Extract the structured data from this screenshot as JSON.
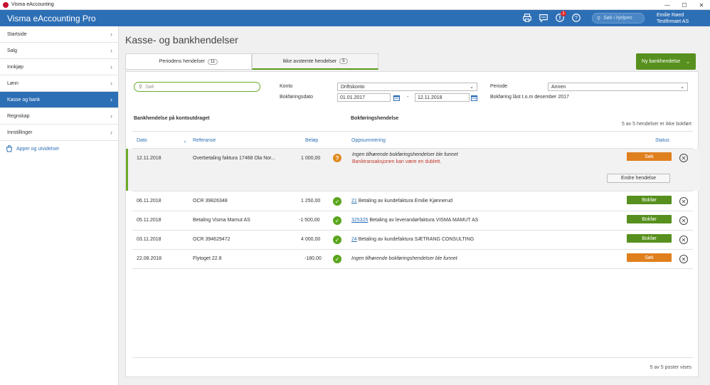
{
  "window": {
    "title": "Visma eAccounting",
    "minimize": "—",
    "maximize": "☐",
    "close": "✕"
  },
  "header": {
    "brand": "Visma eAccounting Pro",
    "notification_count": "1",
    "search_placeholder": "Søk i hjelpen",
    "user_name": "Emilie Røed",
    "company": "Testfirmaet AS"
  },
  "sidebar": {
    "items": [
      {
        "label": "Startside",
        "active": false
      },
      {
        "label": "Salg",
        "active": false
      },
      {
        "label": "Innkjøp",
        "active": false
      },
      {
        "label": "Lønn",
        "active": false
      },
      {
        "label": "Kasse og bank",
        "active": true
      },
      {
        "label": "Regnskap",
        "active": false
      },
      {
        "label": "Innstillinger",
        "active": false
      }
    ],
    "apps_link": "Apper og utvidelser"
  },
  "main": {
    "title": "Kasse- og bankhendelser",
    "tabs": [
      {
        "label": "Periodens hendelser",
        "count": "11"
      },
      {
        "label": "Ikke avstemte hendelser",
        "count": "5"
      }
    ],
    "new_button": "Ny bankhendelse"
  },
  "filters": {
    "search_placeholder": "Søk",
    "account_label": "Konto",
    "account_value": "Driftskonto",
    "date_label": "Bokføringsdato",
    "date_from": "01.01.2017",
    "date_sep": "-",
    "date_to": "12.11.2018",
    "period_label": "Periode",
    "period_value": "Annen",
    "locked_note": "Bokføring låst t.o.m desember 2017"
  },
  "sections": {
    "left": "Bankhendelse på kontoutdraget",
    "right": "Bokføringshendelse",
    "summary": "5 av 5 hendelser er ikke bokført"
  },
  "columns": {
    "date": "Dato",
    "reference": "Referanse",
    "amount": "Beløp",
    "summary": "Oppsummering",
    "status": "Status"
  },
  "rows": [
    {
      "date": "12.11.2018",
      "reference": "Overbetaling faktura 17468 Ola Nor...",
      "amount": "1 000,00",
      "state": "question",
      "link": "",
      "summary": "Ingen tilhørende bokføringshendelser ble funnet",
      "summary_italic": true,
      "warning": "Banktransaksjonen kan være en dublett.",
      "action": "Søk",
      "action_color": "orange",
      "edit": "Endre hendelse"
    },
    {
      "date": "06.11.2018",
      "reference": "OCR 39826348",
      "amount": "1 250,00",
      "state": "ok",
      "link": "21",
      "summary": "Betaling av kundefaktura Emilie Kjønnerud",
      "summary_italic": false,
      "action": "Bokfør",
      "action_color": "green"
    },
    {
      "date": "05.11.2018",
      "reference": "Betaling Visma Mamut AS",
      "amount": "-1 500,00",
      "state": "ok",
      "link": "325325",
      "summary": "Betaling av leverandørfaktura VISMA MAMUT AS",
      "summary_italic": false,
      "action": "Bokfør",
      "action_color": "green"
    },
    {
      "date": "03.11.2018",
      "reference": "OCR 394629472",
      "amount": "4 000,00",
      "state": "ok",
      "link": "24",
      "summary": "Betaling av kundefaktura SÆTRANG CONSULTING",
      "summary_italic": false,
      "action": "Bokfør",
      "action_color": "green"
    },
    {
      "date": "22.08.2018",
      "reference": "Flytoget 22.8",
      "amount": "-180,00",
      "state": "ok",
      "link": "",
      "summary": "Ingen tilhørende bokføringshendelser ble funnet",
      "summary_italic": true,
      "action": "Søk",
      "action_color": "orange"
    }
  ],
  "footer": {
    "count": "5 av 5 poster vises"
  }
}
